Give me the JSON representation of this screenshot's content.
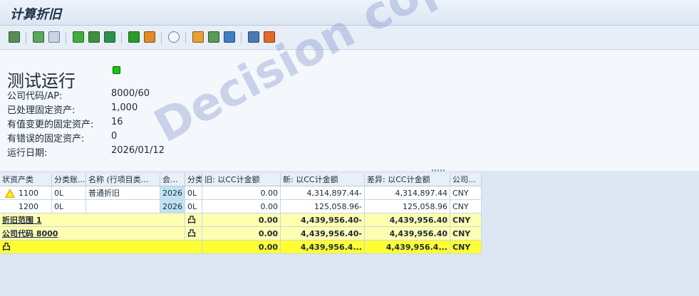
{
  "window": {
    "title": "计算折旧"
  },
  "header": {
    "title": "测试运行",
    "fields": [
      {
        "label": "公司代码/AP:",
        "value": "8000/60"
      },
      {
        "label": "已处理固定资产:",
        "value": "1,000"
      },
      {
        "label": "有值变更的固定资产:",
        "value": "16"
      },
      {
        "label": "有错误的固定资产:",
        "value": "0"
      },
      {
        "label": "运行日期:",
        "value": "2026/01/12"
      }
    ]
  },
  "table": {
    "columns": [
      "状资产类",
      "分类账...",
      "名称 (行项目类...",
      "会...",
      "分类",
      "旧: 以CC计金额",
      "新: 以CC计金额",
      "差异: 以CC计金额",
      "公司..."
    ],
    "rows": [
      {
        "asset_class": "1100",
        "ledger": "0L",
        "name": "普通折旧",
        "year": "2026",
        "cls": "0L",
        "old": "0.00",
        "new": "4,314,897.44-",
        "diff": "4,314,897.44",
        "cur": "CNY"
      },
      {
        "asset_class": "1200",
        "ledger": "0L",
        "name": "",
        "year": "2026",
        "cls": "0L",
        "old": "0.00",
        "new": "125,058.96-",
        "diff": "125,058.96",
        "cur": "CNY"
      }
    ],
    "subtotals": [
      {
        "label": "折旧范围 1",
        "old": "0.00",
        "new": "4,439,956.40-",
        "diff": "4,439,956.40",
        "cur": "CNY"
      },
      {
        "label": "公司代码 8000",
        "old": "0.00",
        "new": "4,439,956.40-",
        "diff": "4,439,956.40",
        "cur": "CNY"
      }
    ],
    "total": {
      "old": "0.00",
      "new": "4,439,956.4...",
      "diff": "4,439,956.4...",
      "cur": "CNY"
    }
  },
  "watermark": "Decision copyright"
}
